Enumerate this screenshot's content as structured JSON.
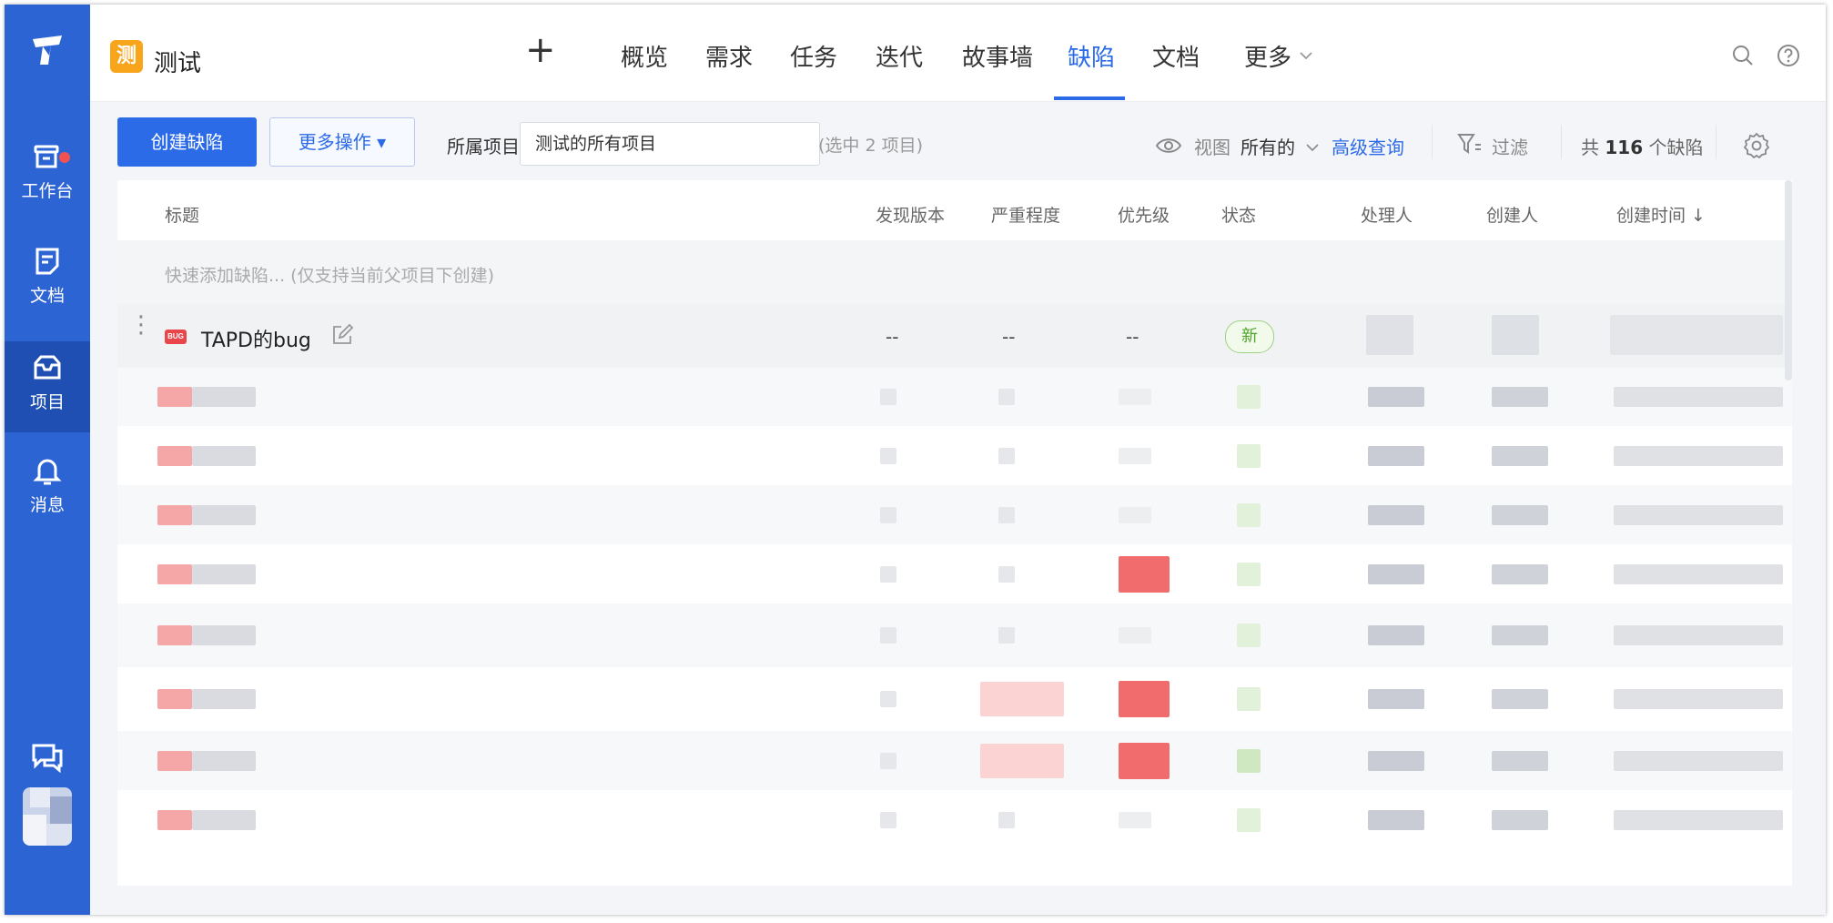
{
  "sidebar": {
    "logo": "tapd-logo-icon",
    "items": [
      {
        "label": "工作台",
        "icon": "workbench-icon",
        "has_dot": true
      },
      {
        "label": "文档",
        "icon": "document-icon"
      },
      {
        "label": "项目",
        "icon": "project-icon",
        "active": true
      },
      {
        "label": "消息",
        "icon": "bell-icon"
      }
    ],
    "bottom_icon": "chat-icon"
  },
  "header": {
    "project_badge": "测",
    "project_name": "测试",
    "add_icon": "+",
    "tabs": [
      "概览",
      "需求",
      "任务",
      "迭代",
      "故事墙",
      "缺陷",
      "文档",
      "更多"
    ],
    "active_tab": "缺陷",
    "right_icons": [
      "search-icon",
      "help-icon"
    ]
  },
  "toolbar": {
    "create_label": "创建缺陷",
    "more_label": "更多操作 ▾",
    "project_label": "所属项目",
    "project_value": "测试的所有项目",
    "selected_info": "(选中 2 项目)",
    "view_label": "视图",
    "view_value": "所有的",
    "advanced_query": "高级查询",
    "filter_label": "过滤",
    "total_prefix": "共",
    "total_count": "116",
    "total_suffix": "个缺陷"
  },
  "table": {
    "columns": [
      "标题",
      "发现版本",
      "严重程度",
      "优先级",
      "状态",
      "处理人",
      "创建人",
      "创建时间 ↓"
    ],
    "quick_add_placeholder": "快速添加缺陷... (仅支持当前父项目下创建)",
    "first_row": {
      "icon_text": "BUG",
      "title": "TAPD的bug",
      "version": "--",
      "severity": "--",
      "priority": "--",
      "status": "新"
    }
  },
  "colors": {
    "sidebar": "#2c64d4",
    "accent": "#2c6be8",
    "bug_red": "#e8464a",
    "status_green": "#52a52b",
    "project_badge": "#f8a51c"
  }
}
